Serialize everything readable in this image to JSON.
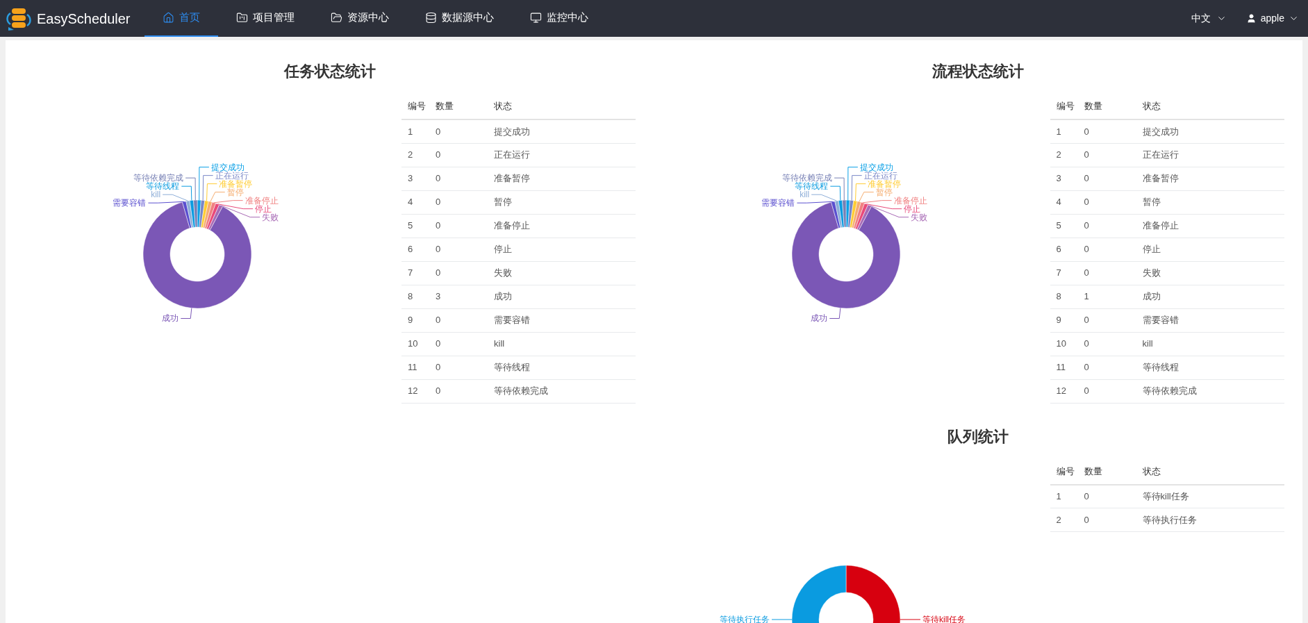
{
  "header": {
    "brand": "EasyScheduler",
    "nav": [
      {
        "label": "首页",
        "selected": true
      },
      {
        "label": "项目管理",
        "selected": false
      },
      {
        "label": "资源中心",
        "selected": false
      },
      {
        "label": "数据源中心",
        "selected": false
      },
      {
        "label": "监控中心",
        "selected": false
      }
    ],
    "language": "中文",
    "user": "apple"
  },
  "task_status": {
    "title": "任务状态统计",
    "donut": {
      "left_labels": [
        "等待依赖完成",
        "等待线程",
        "kill",
        "需要容错",
        "成功"
      ],
      "right_labels": [
        "提交成功",
        "正在运行",
        "准备暂停",
        "暂停",
        "准备停止",
        "停止",
        "失败"
      ]
    },
    "table": {
      "columns": [
        "编号",
        "数量",
        "状态"
      ],
      "rows": [
        [
          "1",
          "0",
          "提交成功"
        ],
        [
          "2",
          "0",
          "正在运行"
        ],
        [
          "3",
          "0",
          "准备暂停"
        ],
        [
          "4",
          "0",
          "暂停"
        ],
        [
          "5",
          "0",
          "准备停止"
        ],
        [
          "6",
          "0",
          "停止"
        ],
        [
          "7",
          "0",
          "失败"
        ],
        [
          "8",
          "3",
          "成功"
        ],
        [
          "9",
          "0",
          "需要容错"
        ],
        [
          "10",
          "0",
          "kill"
        ],
        [
          "11",
          "0",
          "等待线程"
        ],
        [
          "12",
          "0",
          "等待依赖完成"
        ]
      ]
    }
  },
  "process_status": {
    "title": "流程状态统计",
    "donut": {
      "left_labels": [
        "等待依赖完成",
        "等待线程",
        "kill",
        "需要容错",
        "成功"
      ],
      "right_labels": [
        "提交成功",
        "正在运行",
        "准备暂停",
        "暂停",
        "准备停止",
        "停止",
        "失败"
      ]
    },
    "table": {
      "columns": [
        "编号",
        "数量",
        "状态"
      ],
      "rows": [
        [
          "1",
          "0",
          "提交成功"
        ],
        [
          "2",
          "0",
          "正在运行"
        ],
        [
          "3",
          "0",
          "准备暂停"
        ],
        [
          "4",
          "0",
          "暂停"
        ],
        [
          "5",
          "0",
          "准备停止"
        ],
        [
          "6",
          "0",
          "停止"
        ],
        [
          "7",
          "0",
          "失败"
        ],
        [
          "8",
          "1",
          "成功"
        ],
        [
          "9",
          "0",
          "需要容错"
        ],
        [
          "10",
          "0",
          "kill"
        ],
        [
          "11",
          "0",
          "等待线程"
        ],
        [
          "12",
          "0",
          "等待依赖完成"
        ]
      ]
    }
  },
  "queue": {
    "title": "队列统计",
    "donut": {
      "left_labels": [
        "等待执行任务"
      ],
      "right_labels": [
        "等待kill任务"
      ]
    },
    "table": {
      "columns": [
        "编号",
        "数量",
        "状态"
      ],
      "rows": [
        [
          "1",
          "0",
          "等待kill任务"
        ],
        [
          "2",
          "0",
          "等待执行任务"
        ]
      ]
    }
  }
}
